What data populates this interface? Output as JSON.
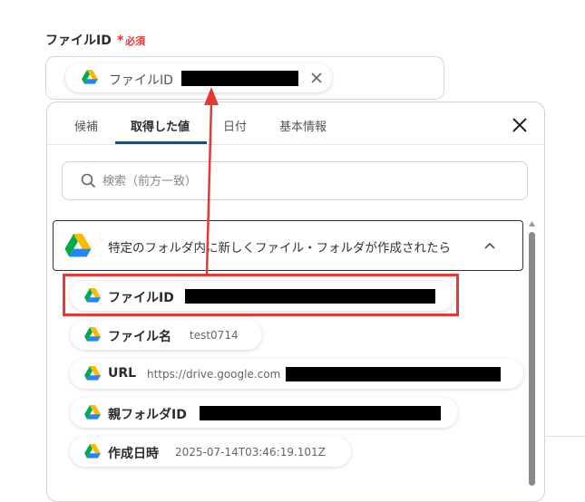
{
  "field": {
    "label": "ファイルID",
    "required_star": "*",
    "required_text": "必須"
  },
  "selected_chip": {
    "icon": "google-drive-icon",
    "label": "ファイルID",
    "value_redacted": true
  },
  "tabs": [
    {
      "label": "候補",
      "active": false
    },
    {
      "label": "取得した値",
      "active": true
    },
    {
      "label": "日付",
      "active": false
    },
    {
      "label": "基本情報",
      "active": false
    }
  ],
  "search": {
    "placeholder": "検索（前方一致）",
    "value": ""
  },
  "group": {
    "title": "特定のフォルダ内に新しくファイル・フォルダが作成されたら",
    "icon": "google-drive-icon",
    "expanded": true
  },
  "items": [
    {
      "label": "ファイルID",
      "value": "",
      "redacted": true,
      "highlighted": true
    },
    {
      "label": "ファイル名",
      "value": "test0714",
      "redacted": false
    },
    {
      "label": "URL",
      "value": "https://drive.google.com",
      "redacted": true
    },
    {
      "label": "親フォルダID",
      "value": "",
      "redacted": true
    },
    {
      "label": "作成日時",
      "value": "2025-07-14T03:46:19.101Z",
      "redacted": false
    }
  ],
  "colors": {
    "required": "#e53935",
    "annotation": "#e53935",
    "tab_underline": "#1f4f6b",
    "redaction": "#000000"
  }
}
